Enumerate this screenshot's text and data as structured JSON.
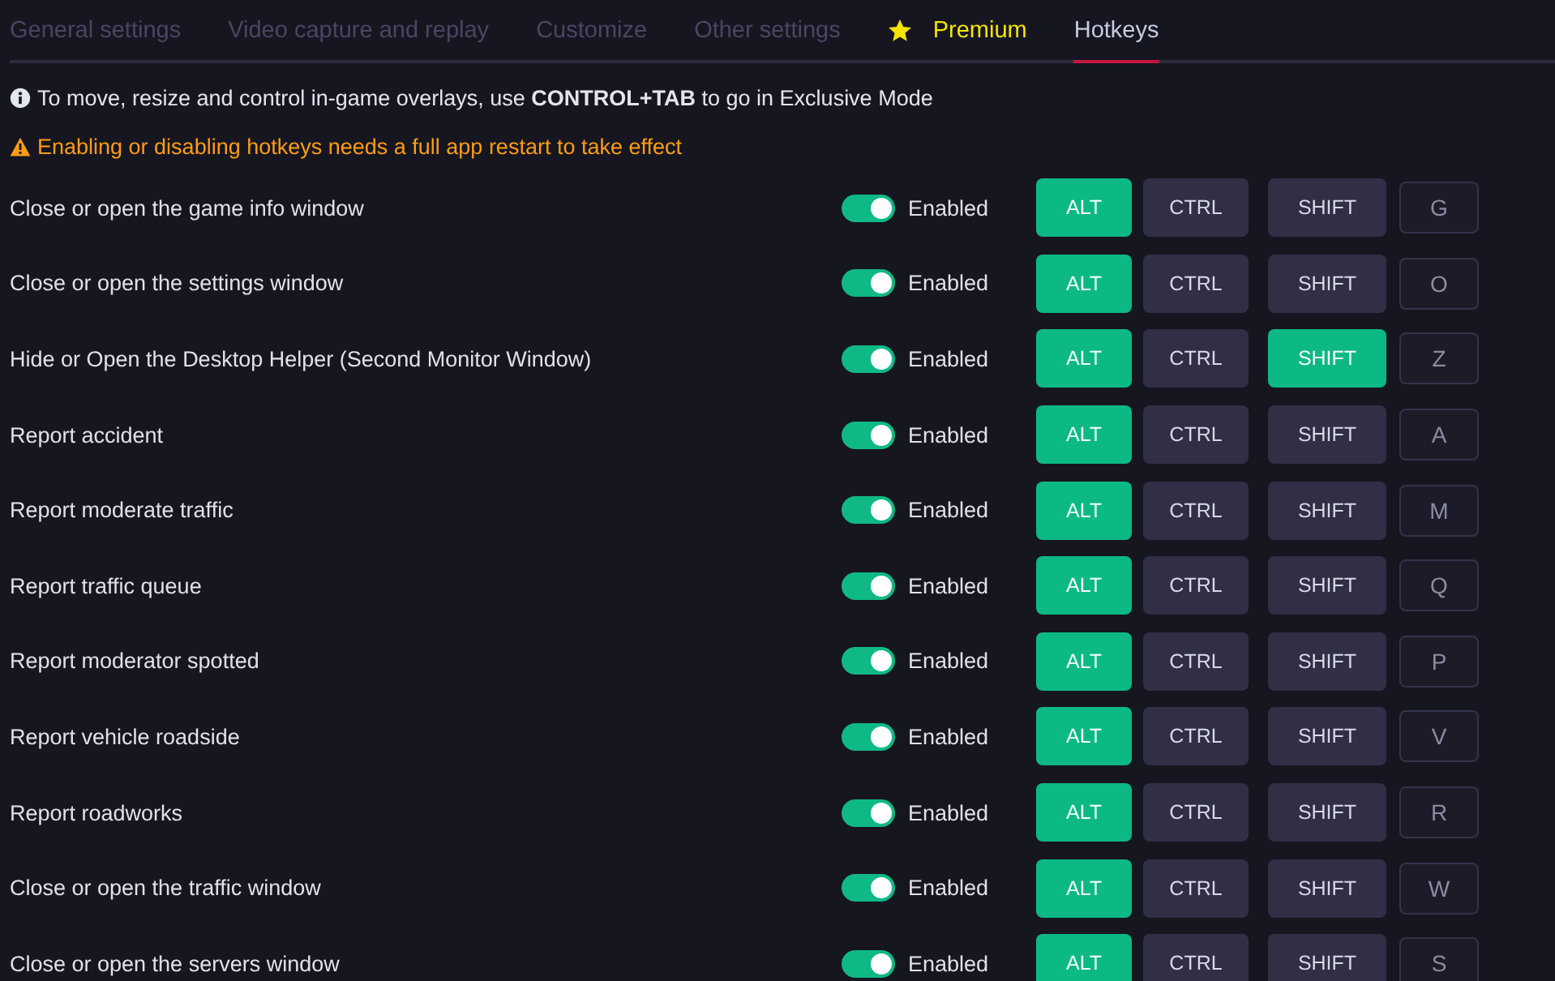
{
  "tabs": [
    {
      "label": "General settings",
      "selected": false,
      "kind": "plain"
    },
    {
      "label": "Video capture and replay",
      "selected": false,
      "kind": "plain"
    },
    {
      "label": "Customize",
      "selected": false,
      "kind": "plain"
    },
    {
      "label": "Other settings",
      "selected": false,
      "kind": "plain"
    },
    {
      "label": "Premium",
      "selected": false,
      "kind": "premium"
    },
    {
      "label": "Hotkeys",
      "selected": true,
      "kind": "plain"
    }
  ],
  "notices": [
    {
      "kind": "info",
      "text": "To move, resize and control in-game overlays, use **CONTROL+TAB** to go in Exclusive Mode"
    },
    {
      "kind": "warning",
      "text": "Enabling or disabling hotkeys needs a full app restart to take effect"
    }
  ],
  "rows": [
    {
      "label": "Close or open the game info window",
      "enabled": true,
      "status": "Enabled",
      "modifiers": [
        {
          "label": "ALT",
          "selected": true
        },
        {
          "label": "CTRL",
          "selected": false
        },
        {
          "label": "SHIFT",
          "selected": false
        }
      ],
      "key": "G"
    },
    {
      "label": "Close or open the settings window",
      "enabled": true,
      "status": "Enabled",
      "modifiers": [
        {
          "label": "ALT",
          "selected": true
        },
        {
          "label": "CTRL",
          "selected": false
        },
        {
          "label": "SHIFT",
          "selected": false
        }
      ],
      "key": "O"
    },
    {
      "label": "Hide or Open the Desktop Helper (Second Monitor Window)",
      "enabled": true,
      "status": "Enabled",
      "modifiers": [
        {
          "label": "ALT",
          "selected": true
        },
        {
          "label": "CTRL",
          "selected": false
        },
        {
          "label": "SHIFT",
          "selected": true
        }
      ],
      "key": "Z"
    },
    {
      "label": "Report accident",
      "enabled": true,
      "status": "Enabled",
      "modifiers": [
        {
          "label": "ALT",
          "selected": true
        },
        {
          "label": "CTRL",
          "selected": false
        },
        {
          "label": "SHIFT",
          "selected": false
        }
      ],
      "key": "A"
    },
    {
      "label": "Report moderate traffic",
      "enabled": true,
      "status": "Enabled",
      "modifiers": [
        {
          "label": "ALT",
          "selected": true
        },
        {
          "label": "CTRL",
          "selected": false
        },
        {
          "label": "SHIFT",
          "selected": false
        }
      ],
      "key": "M"
    },
    {
      "label": "Report traffic queue",
      "enabled": true,
      "status": "Enabled",
      "modifiers": [
        {
          "label": "ALT",
          "selected": true
        },
        {
          "label": "CTRL",
          "selected": false
        },
        {
          "label": "SHIFT",
          "selected": false
        }
      ],
      "key": "Q"
    },
    {
      "label": "Report moderator spotted",
      "enabled": true,
      "status": "Enabled",
      "modifiers": [
        {
          "label": "ALT",
          "selected": true
        },
        {
          "label": "CTRL",
          "selected": false
        },
        {
          "label": "SHIFT",
          "selected": false
        }
      ],
      "key": "P"
    },
    {
      "label": "Report vehicle roadside",
      "enabled": true,
      "status": "Enabled",
      "modifiers": [
        {
          "label": "ALT",
          "selected": true
        },
        {
          "label": "CTRL",
          "selected": false
        },
        {
          "label": "SHIFT",
          "selected": false
        }
      ],
      "key": "V"
    },
    {
      "label": "Report roadworks",
      "enabled": true,
      "status": "Enabled",
      "modifiers": [
        {
          "label": "ALT",
          "selected": true
        },
        {
          "label": "CTRL",
          "selected": false
        },
        {
          "label": "SHIFT",
          "selected": false
        }
      ],
      "key": "R"
    },
    {
      "label": "Close or open the traffic window",
      "enabled": true,
      "status": "Enabled",
      "modifiers": [
        {
          "label": "ALT",
          "selected": true
        },
        {
          "label": "CTRL",
          "selected": false
        },
        {
          "label": "SHIFT",
          "selected": false
        }
      ],
      "key": "W"
    },
    {
      "label": "Close or open the servers window",
      "enabled": true,
      "status": "Enabled",
      "modifiers": [
        {
          "label": "ALT",
          "selected": true
        },
        {
          "label": "CTRL",
          "selected": false
        },
        {
          "label": "SHIFT",
          "selected": false
        }
      ],
      "key": "S"
    }
  ]
}
